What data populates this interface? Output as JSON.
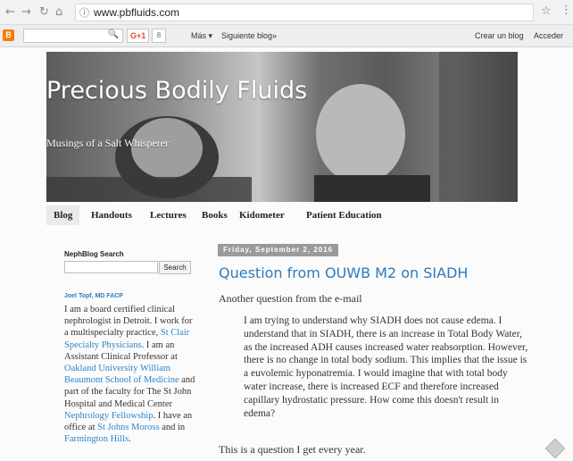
{
  "browser": {
    "back_icon": "←",
    "forward_icon": "→",
    "reload_icon": "↻",
    "home_icon": "⌂",
    "info_icon": "ⓘ",
    "url": "www.pbfluids.com",
    "star_icon": "☆",
    "menu_icon": "⋮"
  },
  "navbar": {
    "logo": "B",
    "search_icon": "🔍",
    "gplus_label": "G+1",
    "gplus_count": "8",
    "more_label": "Más ▾",
    "next_blog_label": "Siguiente blog»",
    "create_blog_label": "Crear un blog",
    "sign_in_label": "Acceder"
  },
  "header": {
    "title": "Precious Bodily Fluids",
    "description": "Musings of a Salt Whisperer"
  },
  "tabs": [
    {
      "label": "Blog"
    },
    {
      "label": "Handouts"
    },
    {
      "label": "Lectures"
    },
    {
      "label": "Books"
    },
    {
      "label": "Kidometer"
    },
    {
      "label": "Patient Education"
    }
  ],
  "sidebar": {
    "search_title": "NephBlog Search",
    "search_button": "Search",
    "author_name": "Joel Topf, MD FACP",
    "bio": {
      "t1": "I am a board certified clinical nephrologist in Detroit. I work for a multispecialty practice, ",
      "l1": "St Clair Specialty Physicians",
      "t2": ". I am an Assistant Clinical Professor at ",
      "l2": "Oakland University William Beaumont School of Medicine",
      "t3": " and part of the faculty for The St John Hospital and Medical Center ",
      "l3": "Nephrology Fellowship",
      "t4": ". I have an office at ",
      "l4": "St Johns Moross",
      "t5": " and in ",
      "l5": "Farmington Hills",
      "t6": "."
    }
  },
  "post": {
    "date": "Friday, September 2, 2016",
    "title": "Question from OUWB M2 on SIADH",
    "intro": "Another question from the e-mail",
    "quote": "I am trying to understand why SIADH does not cause edema. I understand that in SIADH, there is an increase in Total Body Water, as the increased ADH causes increased water reabsorption. However, there is no change in total body sodium. This implies that the issue is a euvolemic hyponatremia. I would imagine that with total body water increase, there is increased ECF and therefore increased capillary hydrostatic pressure. How come this doesn't result in edema?",
    "outro": "This is a question I get every year."
  }
}
